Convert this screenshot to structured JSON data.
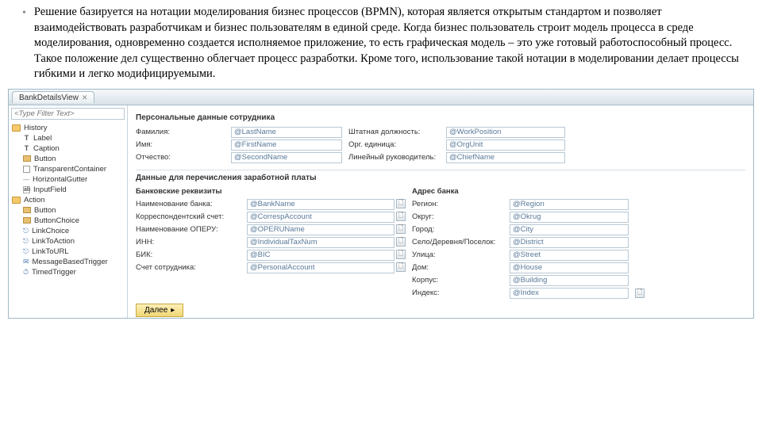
{
  "bullet": "Решение базируется на нотации моделирования бизнес процессов (BPMN), которая является открытым стандартом и позволяет взаимодействовать разработчикам и бизнес пользователям в единой среде. Когда бизнес пользователь строит модель процесса в среде моделирования, одновременно создается исполняемое приложение, то есть графическая модель – это уже готовый работоспособный процесс. Такое положение дел существенно облегчает процесс разработки. Кроме того, использование такой нотации в моделировании делает процессы гибкими и легко модифицируемыми.",
  "tab_title": "BankDetailsView",
  "filter_placeholder": "<Type Filter Text>",
  "tree": {
    "history": "History",
    "label": "Label",
    "caption": "Caption",
    "button": "Button",
    "transparent": "TransparentContainer",
    "gutter": "HorizontalGutter",
    "input": "InputField",
    "action": "Action",
    "a_button": "Button",
    "a_buttonchoice": "ButtonChoice",
    "a_linkchoice": "LinkChoice",
    "a_linktoaction": "LinkToAction",
    "a_linktourl": "LinkToURL",
    "a_msgtrigger": "MessageBasedTrigger",
    "a_timedtrigger": "TimedTrigger"
  },
  "section1_title": "Персональные данные сотрудника",
  "personal": [
    {
      "l1": "Фамилия:",
      "v1": "@LastName",
      "l2": "Штатная должность:",
      "v2": "@WorkPosition"
    },
    {
      "l1": "Имя:",
      "v1": "@FirstName",
      "l2": "Орг. единица:",
      "v2": "@OrgUnit"
    },
    {
      "l1": "Отчество:",
      "v1": "@SecondName",
      "l2": "Линейный руководитель:",
      "v2": "@ChiefName"
    }
  ],
  "section2_title": "Данные для перечисления заработной платы",
  "col1_title": "Банковские реквизиты",
  "col2_title": "Адрес банка",
  "bank": [
    {
      "l1": "Наименование банка:",
      "v1": "@BankName",
      "l2": "Регион:",
      "v2": "@Region"
    },
    {
      "l1": "Корреспондентский счет:",
      "v1": "@CorrespAccount",
      "l2": "Округ:",
      "v2": "@Okrug"
    },
    {
      "l1": "Наименование ОПЕРУ:",
      "v1": "@OPERUName",
      "l2": "Город:",
      "v2": "@City"
    },
    {
      "l1": "ИНН:",
      "v1": "@IndividualTaxNum",
      "l2": "Село/Деревня/Поселок:",
      "v2": "@District"
    },
    {
      "l1": "БИК:",
      "v1": "@BIC",
      "l2": "Улица:",
      "v2": "@Street"
    },
    {
      "l1": "Счет сотрудника:",
      "v1": "@PersonalAccount",
      "l2": "Дом:",
      "v2": "@House"
    },
    {
      "l1": "",
      "v1": "",
      "l2": "Корпус:",
      "v2": "@Building"
    },
    {
      "l1": "",
      "v1": "",
      "l2": "Индекс:",
      "v2": "@Index"
    }
  ],
  "next_btn": "Далее",
  "picker_glyph": "🗋"
}
